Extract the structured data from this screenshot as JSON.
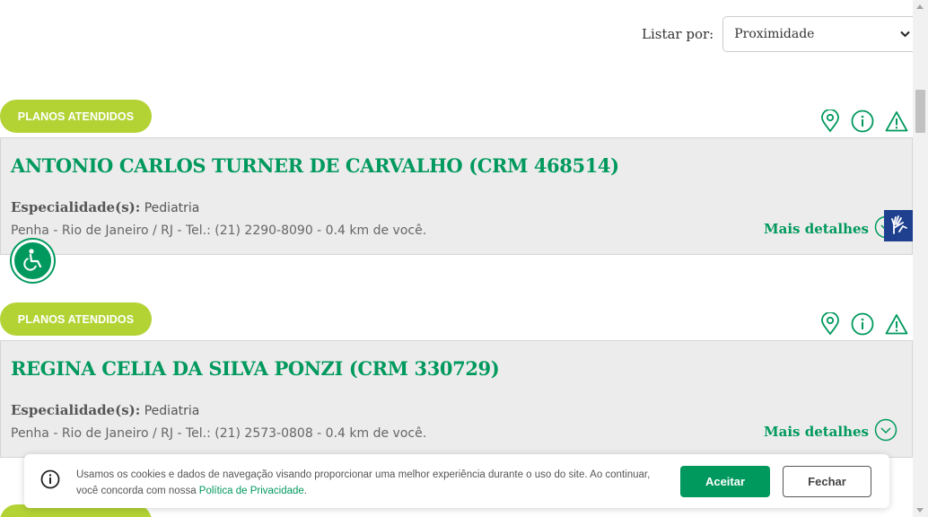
{
  "sort": {
    "label": "Listar por:",
    "selected": "Proximidade"
  },
  "results": [
    {
      "plans_label": "PLANOS ATENDIDOS",
      "name": "ANTONIO CARLOS TURNER DE CARVALHO (CRM 468514)",
      "specialty_key": "Especialidade(s):",
      "specialty": "Pediatria",
      "address": "Penha - Rio de Janeiro / RJ - Tel.: (21) 2290-8090 - 0.4 km de você.",
      "more_label": "Mais detalhes"
    },
    {
      "plans_label": "PLANOS ATENDIDOS",
      "name": "REGINA CELIA DA SILVA PONZI (CRM 330729)",
      "specialty_key": "Especialidade(s):",
      "specialty": "Pediatria",
      "address": "Penha - Rio de Janeiro / RJ - Tel.: (21) 2573-0808 - 0.4 km de você.",
      "more_label": "Mais detalhes"
    }
  ],
  "cookie": {
    "text": "Usamos os cookies e dados de navegação visando proporcionar uma melhor experiência durante o uso do site. Ao continuar, você concorda com nossa ",
    "link": "Política de Privacidade",
    "suffix": ".",
    "accept": "Aceitar",
    "close": "Fechar"
  },
  "icons": [
    "map-pin-icon",
    "info-icon",
    "warning-icon",
    "chevron-down-icon",
    "wheelchair-icon",
    "sign-language-icon"
  ],
  "colors": {
    "brand_green": "#00995d",
    "pill_green": "#b3d335",
    "card_bg": "#ececec",
    "libras_blue": "#1f3f8f"
  }
}
